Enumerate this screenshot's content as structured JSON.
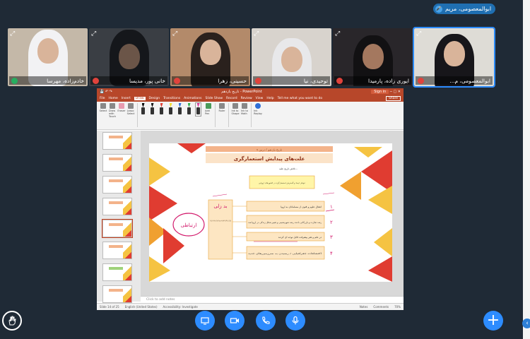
{
  "top_badge": {
    "name": "ابوالمعصومی، مریم"
  },
  "participants": [
    {
      "name": "خادم‌زاده، مهرسا",
      "mic": "on"
    },
    {
      "name": "خانی پور، مدیسا",
      "mic": "muted"
    },
    {
      "name": "حسینی، زهرا",
      "mic": "muted"
    },
    {
      "name": "توحیدی، نیا",
      "mic": "muted"
    },
    {
      "name": "ایوری زاده، پارمیدا",
      "mic": "muted"
    },
    {
      "name": "ابوالمعصومی، م...",
      "mic": "muted",
      "active": true
    }
  ],
  "ppt": {
    "title": "تاریخ یازدهم - PowerPoint",
    "signin_label": "Sign in",
    "tabs": [
      "File",
      "Home",
      "Insert",
      "Draw",
      "Design",
      "Transitions",
      "Animations",
      "Slide Show",
      "Record",
      "Review",
      "View",
      "Help",
      "Tell me what you want to do"
    ],
    "selected_tab": "Draw",
    "share_label": "Share",
    "ribbon_tools": [
      "Select",
      "Draw with Touch",
      "Eraser",
      "Lasso Select"
    ],
    "ribbon_right": [
      "Add Pen",
      "Ruler",
      "Ink to Shape",
      "Ink to Math",
      "Ink Replay"
    ],
    "group_labels": [
      "Tools",
      "Pens",
      "Stencils",
      "Convert",
      "Replay"
    ],
    "slide_numbers": [
      "9",
      "10",
      "11",
      "12",
      "13",
      "14",
      "15",
      "16",
      "17",
      "18"
    ],
    "notes_placeholder": "Click to add notes",
    "status": {
      "slide_of": "Slide 14 of 25",
      "language": "English (United States)",
      "accessibility": "Accessibility: Investigate",
      "notes_btn": "Notes",
      "comments_btn": "Comments",
      "zoom": "70%"
    }
  },
  "slide": {
    "header": "تاریخ یازدهم / درس ۷",
    "title": "علت‌های پیدایش استعمارگری",
    "subtitle": "تلاش تاریخ علیه...",
    "yellow_box": "عوامل ایجاد و گسترش استعمارگری در کشورهای اروپایی",
    "left_handwriting": "بد زلی",
    "left_scribble": "ارتباطی",
    "left_column_text": "اروپاییان از راه دریا و کشتیرانی به کشورها رسیدند و سرزمین‌ها را تصرف کردند و مواد خام را به اروپا بردند",
    "items": [
      {
        "num": "۱",
        "text": "انتقال علوم و فنون از مسلمانان به اروپا"
      },
      {
        "num": "۲",
        "text": "رشد تجارت و بازرگانی باعث رشد شهرنشینی و تغییر شکل زندگی در اروپا شد"
      },
      {
        "num": "۳",
        "text": "در علم و هنر پیشرفت قابل توجه ای کردند"
      },
      {
        "num": "۴",
        "text": "اکتشافات جغرافیایی / رسیدن به سرزمین‌های جدید"
      }
    ]
  },
  "colors": {
    "accent": "#2d8cff",
    "ppt_red": "#b7472a",
    "slide_orange": "#f0a030",
    "slide_red": "#e03c31",
    "slide_yellow": "#f5c342"
  }
}
